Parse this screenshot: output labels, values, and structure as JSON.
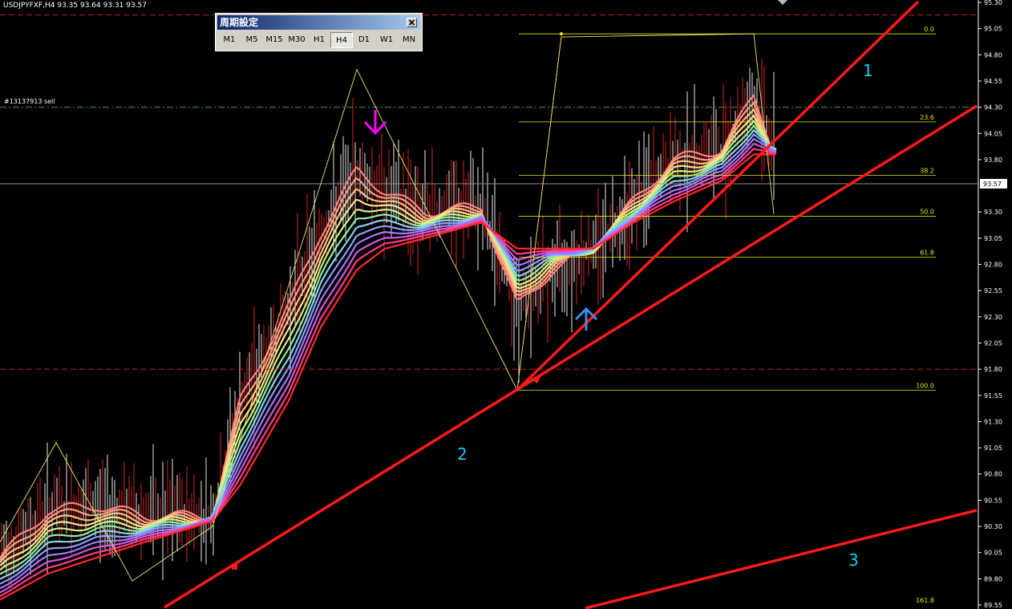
{
  "header": {
    "symbol_line": "USDJPYFXF,H4  93.35 93.64 93.31 93.57"
  },
  "order_label": "#13137913 sell",
  "period_panel": {
    "title": "周期設定",
    "buttons": [
      "M1",
      "M5",
      "M15",
      "M30",
      "H1",
      "H4",
      "D1",
      "W1",
      "MN"
    ],
    "active": "H4"
  },
  "colors": {
    "background": "#000000",
    "trendline": "#ff1a1a",
    "fib": "#e8e800",
    "label": "#22c8f0",
    "down_arrow": "#ff00ff",
    "up_arrow": "#3c8cf0"
  },
  "chart_data": {
    "type": "line",
    "symbol": "USDJPYFXF",
    "timeframe": "H4",
    "ohlc_current": {
      "open": 93.35,
      "high": 93.64,
      "low": 93.31,
      "close": 93.57
    },
    "current_price": "93.57",
    "ylim": [
      89.55,
      95.3
    ],
    "y_ticks": [
      "95.30",
      "95.05",
      "94.80",
      "94.55",
      "94.30",
      "94.05",
      "93.80",
      "93.57",
      "93.30",
      "93.05",
      "92.80",
      "92.55",
      "92.30",
      "92.05",
      "91.80",
      "91.55",
      "91.30",
      "91.05",
      "90.80",
      "90.55",
      "90.30",
      "90.05",
      "89.80",
      "89.55"
    ],
    "fib_levels": [
      {
        "label": "0.0",
        "price": 95.0
      },
      {
        "label": "23.6",
        "price": 94.16
      },
      {
        "label": "38.2",
        "price": 93.65
      },
      {
        "label": "50.0",
        "price": 93.26
      },
      {
        "label": "61.8",
        "price": 92.87
      },
      {
        "label": "100.0",
        "price": 91.6
      },
      {
        "label": "161.8",
        "price": 89.55
      }
    ],
    "horizontal_lines": [
      {
        "name": "resistance",
        "price": 95.18,
        "style": "dash"
      },
      {
        "name": "sell-order",
        "price": 94.3,
        "style": "dash-dot"
      },
      {
        "name": "support",
        "price": 91.8,
        "style": "dash"
      },
      {
        "name": "current",
        "price": 93.57,
        "style": "solid"
      }
    ],
    "trendline_labels": [
      "1",
      "2",
      "3"
    ],
    "zigzag": [
      [
        0,
        90.15
      ],
      [
        70,
        91.1
      ],
      [
        165,
        89.78
      ],
      [
        265,
        90.3
      ],
      [
        445,
        94.66
      ],
      [
        645,
        91.6
      ],
      [
        700,
        94.97
      ],
      [
        940,
        95.0
      ],
      [
        965,
        93.28
      ]
    ],
    "ma_ribbon_colors": [
      "#ff7f7f",
      "#ff9f7f",
      "#ffc080",
      "#f5e68c",
      "#d2f08c",
      "#8cf0a0",
      "#8cd2f0",
      "#8ca0ff",
      "#a07cff",
      "#d25adc",
      "#ff3c8c",
      "#ff2828"
    ],
    "ma_ribbon_anchor": [
      [
        0,
        90.0
      ],
      [
        60,
        90.45
      ],
      [
        120,
        90.5
      ],
      [
        180,
        90.4
      ],
      [
        265,
        90.4
      ],
      [
        300,
        91.5
      ],
      [
        360,
        92.4
      ],
      [
        400,
        93.1
      ],
      [
        445,
        93.7
      ],
      [
        480,
        93.5
      ],
      [
        530,
        93.3
      ],
      [
        600,
        93.35
      ],
      [
        645,
        92.4
      ],
      [
        690,
        92.75
      ],
      [
        740,
        92.95
      ],
      [
        790,
        93.4
      ],
      [
        840,
        93.8
      ],
      [
        900,
        93.9
      ],
      [
        940,
        94.4
      ],
      [
        965,
        93.9
      ]
    ],
    "ma_ribbon_target": [
      [
        0,
        89.6
      ],
      [
        60,
        89.85
      ],
      [
        120,
        90.0
      ],
      [
        180,
        90.15
      ],
      [
        265,
        90.35
      ],
      [
        300,
        90.7
      ],
      [
        360,
        91.5
      ],
      [
        400,
        92.2
      ],
      [
        445,
        92.75
      ],
      [
        480,
        92.95
      ],
      [
        530,
        93.05
      ],
      [
        600,
        93.2
      ],
      [
        645,
        92.95
      ],
      [
        690,
        92.95
      ],
      [
        740,
        92.95
      ],
      [
        790,
        93.2
      ],
      [
        840,
        93.4
      ],
      [
        900,
        93.6
      ],
      [
        940,
        93.85
      ],
      [
        965,
        93.85
      ]
    ]
  }
}
